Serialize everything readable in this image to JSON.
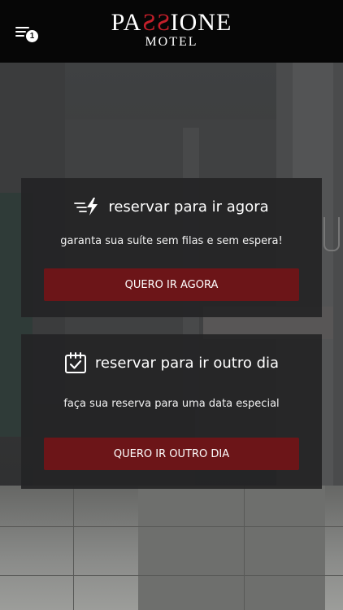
{
  "header": {
    "menu_badge_count": "1",
    "logo": {
      "prefix": "PA",
      "mark": "SS",
      "suffix": "IONE",
      "sub": "MOTEL"
    }
  },
  "cards": {
    "now": {
      "icon": "fast-lightning-icon",
      "title": "reservar para ir agora",
      "subtitle": "garanta sua suíte sem filas e sem espera!",
      "button_label": "QUERO IR AGORA"
    },
    "later": {
      "icon": "calendar-check-icon",
      "title": "reservar para ir outro dia",
      "subtitle": "faça sua reserva para uma data especial",
      "button_label": "QUERO IR OUTRO DIA"
    }
  },
  "colors": {
    "header_bg": "#060606",
    "brand_red": "#c41f2a",
    "button_bg": "#6c1518",
    "card_bg": "#242425"
  }
}
